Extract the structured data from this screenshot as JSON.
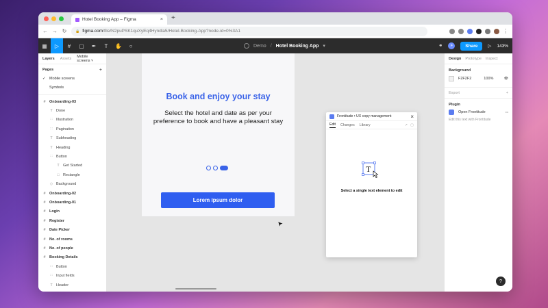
{
  "browser": {
    "tab_title": "Hotel Booking App – Figma",
    "tab_close": "×",
    "new_tab": "+",
    "url_host": "figma.com",
    "url_rest": "/file/N2puPSK1quXyEq4Hyndla5/Hotel-Booking-App?node-id=0%3A1",
    "nav_back": "←",
    "nav_forward": "→",
    "nav_reload": "↻",
    "lock_icon": "🔒"
  },
  "toolbar": {
    "project": "Demo",
    "separator": "/",
    "file_name": "Hotel Booking App",
    "file_caret": "▾",
    "share_label": "Share",
    "zoom": "143%",
    "avatar_initial": "F",
    "play_icon": "▷",
    "tools": [
      "▦",
      "▷",
      "#",
      "▢",
      "✒",
      "T",
      "✋",
      "○"
    ]
  },
  "left_panel": {
    "tab_layers": "Layers",
    "tab_assets": "Assets",
    "page_selector": "Mobile screens ˅",
    "pages_heading": "Pages",
    "add_page": "+",
    "pages": [
      {
        "label": "Mobile screens",
        "check": "✓"
      },
      {
        "label": "Symbols",
        "check": ""
      }
    ],
    "layers": [
      {
        "label": "Onboarding-03",
        "icon": "#",
        "kind": "f"
      },
      {
        "label": "Done",
        "icon": "T",
        "kind": "c"
      },
      {
        "label": "Illustration",
        "icon": "∷",
        "kind": "c"
      },
      {
        "label": "Pagination",
        "icon": "∷",
        "kind": "c"
      },
      {
        "label": "Subheading",
        "icon": "T",
        "kind": "c"
      },
      {
        "label": "Heading",
        "icon": "T",
        "kind": "c"
      },
      {
        "label": "Button",
        "icon": "∷",
        "kind": "c"
      },
      {
        "label": "Get Started",
        "icon": "T",
        "kind": "gc"
      },
      {
        "label": "Rectangle",
        "icon": "□",
        "kind": "gc"
      },
      {
        "label": "Background",
        "icon": "◇",
        "kind": "c"
      },
      {
        "label": "Onboarding-02",
        "icon": "#",
        "kind": "f"
      },
      {
        "label": "Onboarding-01",
        "icon": "#",
        "kind": "f"
      },
      {
        "label": "Login",
        "icon": "#",
        "kind": "f"
      },
      {
        "label": "Register",
        "icon": "#",
        "kind": "f"
      },
      {
        "label": "Date Picker",
        "icon": "#",
        "kind": "f"
      },
      {
        "label": "No. of rooms",
        "icon": "#",
        "kind": "f"
      },
      {
        "label": "No. of people",
        "icon": "#",
        "kind": "f"
      },
      {
        "label": "Booking Details",
        "icon": "#",
        "kind": "f"
      },
      {
        "label": "Button",
        "icon": "∷",
        "kind": "c"
      },
      {
        "label": "Input fields",
        "icon": "∷",
        "kind": "c"
      },
      {
        "label": "Header",
        "icon": "T",
        "kind": "c"
      },
      {
        "label": "Heading",
        "icon": "T",
        "kind": "c"
      }
    ]
  },
  "canvas": {
    "heading": "Book and enjoy your stay",
    "subheading": "Select the hotel and date as per your preference to book and have a pleasant stay",
    "cta_label": "Lorem ipsum dolor",
    "cursor": "➤"
  },
  "plugin": {
    "title": "Frontitude • UX copy management",
    "close": "×",
    "tabs": [
      "Edit",
      "Changes",
      "Library"
    ],
    "tab_icons": [
      "↗",
      "▢"
    ],
    "message": "Select a single text element to edit"
  },
  "right_panel": {
    "tabs": [
      "Design",
      "Prototype",
      "Inspect"
    ],
    "background_heading": "Background",
    "bg_hex": "F2F2F2",
    "bg_opacity": "100%",
    "eye_icon": "👁",
    "export_label": "Export",
    "export_add": "+",
    "plugin_heading": "Plugin",
    "plugin_name": "Open Frontitude",
    "plugin_more": "•••",
    "plugin_hint": "Edit this text with Frontitude"
  },
  "help_label": "?",
  "colors": {
    "accent": "#0D99FF",
    "brand_blue": "#2F5EF0",
    "heading_blue": "#3A63E8"
  }
}
